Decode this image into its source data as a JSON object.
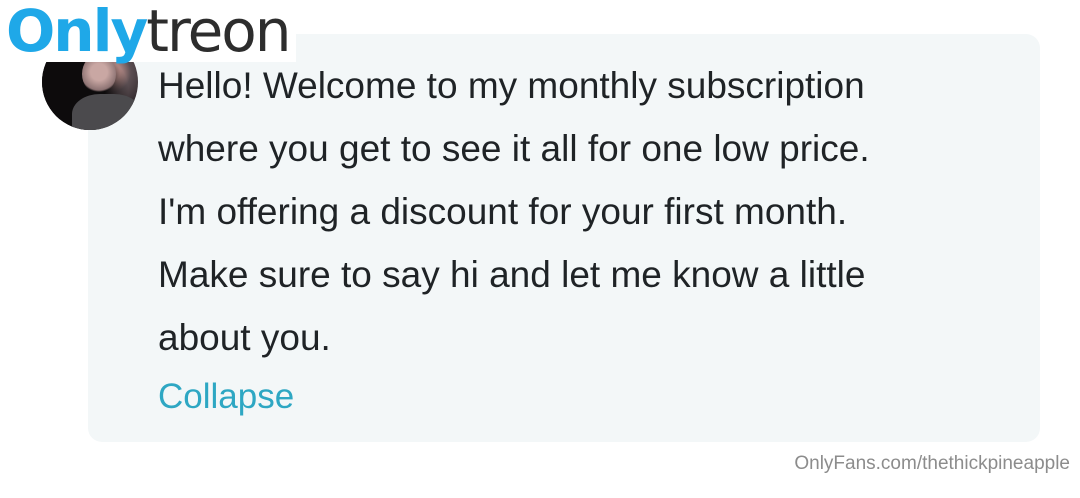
{
  "logo": {
    "part1": "Only",
    "part2": "treon"
  },
  "message": {
    "lines": [
      "Hello! Welcome to my monthly subscription",
      "where you get to see it all for one low price.",
      "I'm offering a discount for your first month.",
      "Make sure to say hi and let me know a little",
      "about you."
    ],
    "collapse_label": "Collapse"
  },
  "watermark": "OnlyFans.com/thethickpineapple",
  "colors": {
    "bubble_bg": "#f3f7f8",
    "text": "#1f2326",
    "link": "#2ea7c3",
    "logo_blue": "#1fa8e8",
    "logo_dark": "#2d2d2d"
  }
}
